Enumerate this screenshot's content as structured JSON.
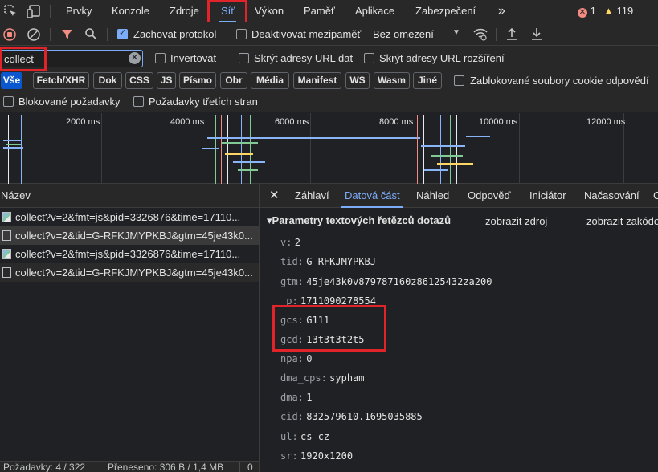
{
  "tabs": {
    "items": [
      "Prvky",
      "Konzole",
      "Zdroje",
      "Síť",
      "Výkon",
      "Paměť",
      "Aplikace",
      "Zabezpečení"
    ],
    "more": "»",
    "errors_count": "1",
    "warnings_count": "119"
  },
  "toolbar": {
    "preserve_log": "Zachovat protokol",
    "disable_cache": "Deaktivovat mezipaměť",
    "throttling": "Bez omezení"
  },
  "filter": {
    "value": "collect",
    "invert": "Invertovat",
    "hide_data_urls": "Skrýt adresy URL dat",
    "hide_ext_urls": "Skrýt adresy URL rozšíření"
  },
  "type_filters": [
    "Vše",
    "Fetch/XHR",
    "Dok",
    "CSS",
    "JS",
    "Písmo",
    "Obr",
    "Média",
    "Manifest",
    "WS",
    "Wasm",
    "Jiné"
  ],
  "blocked_cookies": "Zablokované soubory cookie odpovědí",
  "blocked_requests": "Blokované požadavky",
  "third_party": "Požadavky třetích stran",
  "timeline": {
    "ticks": [
      "2000 ms",
      "4000 ms",
      "6000 ms",
      "8000 ms",
      "10000 ms",
      "12000 ms"
    ]
  },
  "requests": {
    "header": "Název",
    "items": [
      "collect?v=2&fmt=js&pid=3326876&time=17110...",
      "collect?v=2&tid=G-RFKJMYPKBJ&gtm=45je43k0...",
      "collect?v=2&fmt=js&pid=3326876&time=17110...",
      "collect?v=2&tid=G-RFKJMYPKBJ&gtm=45je43k0..."
    ]
  },
  "status": {
    "requests": "Požadavky: 4 / 322",
    "transferred": "Přeneseno: 306 B / 1,4 MB",
    "extra": "0"
  },
  "details": {
    "close": "✕",
    "tabs": [
      "Záhlaví",
      "Datová část",
      "Náhled",
      "Odpověď",
      "Iniciátor",
      "Načasování",
      "C"
    ],
    "section_title": "▾Parametry textových řetězců dotazů",
    "view_source": "zobrazit zdroj",
    "view_decoded": "zobrazit zakódo",
    "params": [
      {
        "key": "v:",
        "value": "2"
      },
      {
        "key": "tid:",
        "value": "G-RFKJMYPKBJ"
      },
      {
        "key": "gtm:",
        "value": "45je43k0v879787160z86125432za200"
      },
      {
        "key": "_p:",
        "value": "1711090278554"
      },
      {
        "key": "gcs:",
        "value": "G111"
      },
      {
        "key": "gcd:",
        "value": "13t3t3t2t5"
      },
      {
        "key": "npa:",
        "value": "0"
      },
      {
        "key": "dma_cps:",
        "value": "sypham"
      },
      {
        "key": "dma:",
        "value": "1"
      },
      {
        "key": "cid:",
        "value": "832579610.1695035885"
      },
      {
        "key": "ul:",
        "value": "cs-cz"
      },
      {
        "key": "sr:",
        "value": "1920x1200"
      }
    ]
  }
}
